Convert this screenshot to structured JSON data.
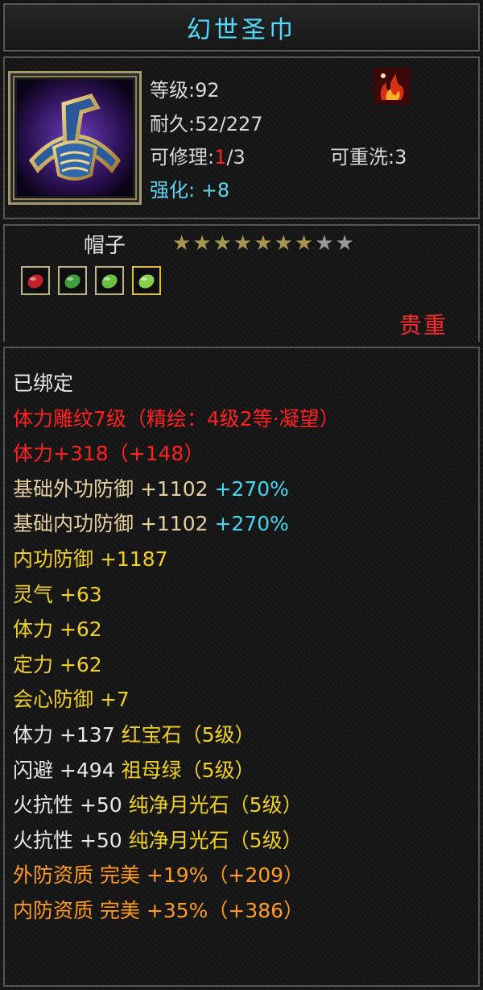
{
  "item": {
    "title": "幻世圣巾",
    "level_label": "等级:92",
    "durability_label": "耐久:52/227",
    "repair_prefix": "可修理:",
    "repair_used": "1",
    "repair_total": "/3",
    "rewash_label": "可重洗:3",
    "enhance_label": "强化: +8",
    "name": "帽子",
    "rarity": "贵重",
    "stars_filled": 7,
    "stars_total": 9,
    "icon": "headband-icon",
    "badge_icon": "flame-badge-icon"
  },
  "gems": [
    {
      "icon": "ruby-gem-icon",
      "color": "#c0202a"
    },
    {
      "icon": "emerald-gem-icon",
      "color": "#40a040"
    },
    {
      "icon": "moonstone-gem-icon",
      "color": "#6ac040"
    },
    {
      "icon": "moonstone-gem-icon",
      "color": "#8ad050"
    }
  ],
  "stats": [
    {
      "parts": [
        {
          "t": "已绑定",
          "c": "white"
        }
      ]
    },
    {
      "parts": [
        {
          "t": "体力雕纹7级（精绘：4级2等·凝望）",
          "c": "red"
        }
      ]
    },
    {
      "parts": [
        {
          "t": "体力+318（+148）",
          "c": "red"
        }
      ]
    },
    {
      "parts": [
        {
          "t": "基础外功防御 +1102 ",
          "c": "wheat"
        },
        {
          "t": "+270%",
          "c": "cyan"
        }
      ]
    },
    {
      "parts": [
        {
          "t": "基础内功防御 +1102 ",
          "c": "wheat"
        },
        {
          "t": "+270%",
          "c": "cyan"
        }
      ]
    },
    {
      "parts": [
        {
          "t": "内功防御 +1187",
          "c": "yellow"
        }
      ]
    },
    {
      "parts": [
        {
          "t": "灵气 +63",
          "c": "yellow"
        }
      ]
    },
    {
      "parts": [
        {
          "t": "体力 +62",
          "c": "yellow"
        }
      ]
    },
    {
      "parts": [
        {
          "t": "定力 +62",
          "c": "yellow"
        }
      ]
    },
    {
      "parts": [
        {
          "t": "会心防御 +7",
          "c": "yellow"
        }
      ]
    },
    {
      "parts": [
        {
          "t": "体力 +137 ",
          "c": "white"
        },
        {
          "t": "红宝石（5级）",
          "c": "yellow"
        }
      ]
    },
    {
      "parts": [
        {
          "t": "闪避 +494 ",
          "c": "white"
        },
        {
          "t": "祖母绿（5级）",
          "c": "yellow"
        }
      ]
    },
    {
      "parts": [
        {
          "t": "火抗性 +50 ",
          "c": "white"
        },
        {
          "t": "纯净月光石（5级）",
          "c": "yellow"
        }
      ]
    },
    {
      "parts": [
        {
          "t": "火抗性 +50 ",
          "c": "white"
        },
        {
          "t": "纯净月光石（5级）",
          "c": "yellow"
        }
      ]
    },
    {
      "parts": [
        {
          "t": "外防资质  完美 +19%（+209）",
          "c": "orange"
        }
      ]
    },
    {
      "parts": [
        {
          "t": "内防资质  完美 +35%（+386）",
          "c": "orange"
        }
      ]
    }
  ]
}
